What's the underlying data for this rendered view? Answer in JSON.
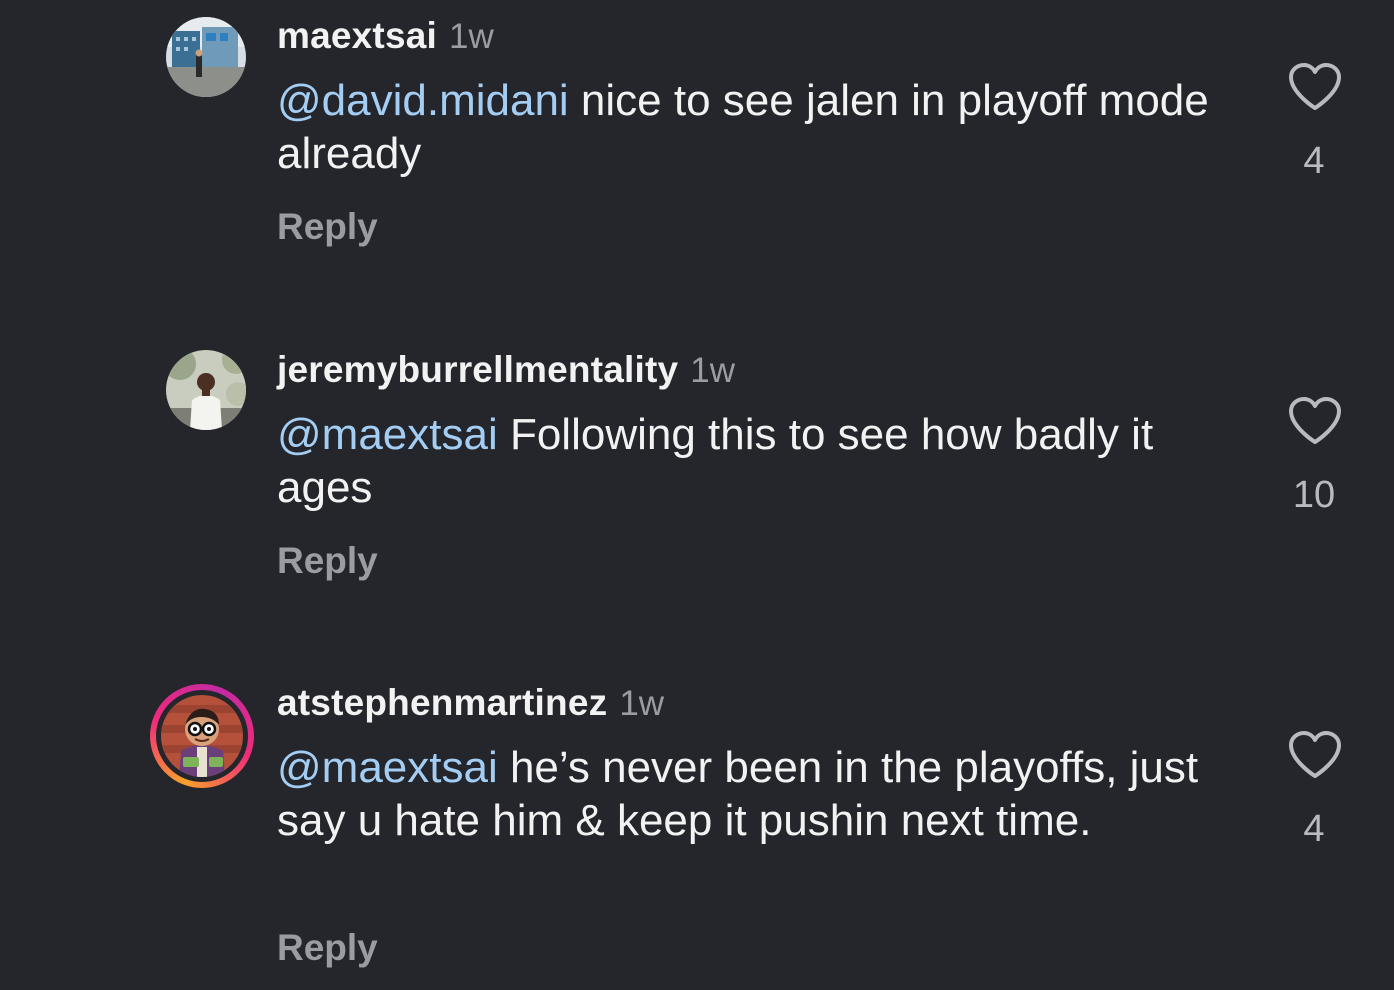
{
  "comments": [
    {
      "username": "maextsai",
      "time": "1w",
      "mention": "@david.midani",
      "text": " nice to see jalen in playoff mode already",
      "reply": "Reply",
      "likes": "4",
      "avatar_icon": "profile-photo-building",
      "has_story_ring": false
    },
    {
      "username": "jeremyburrellmentality",
      "time": "1w",
      "mention": "@maextsai",
      "text": " Following this to see how badly it ages",
      "reply": "Reply",
      "likes": "10",
      "avatar_icon": "profile-photo-person",
      "has_story_ring": false
    },
    {
      "username": "atstephenmartinez",
      "time": "1w",
      "mention": "@maextsai",
      "text": " he’s never been in the playoffs, just say u hate him & keep it pushin next time.",
      "reply": "Reply",
      "likes": "4",
      "avatar_icon": "profile-illustration-cartoon",
      "has_story_ring": true
    }
  ],
  "colors": {
    "background": "#24262b",
    "mention": "#a3cdf3",
    "muted": "#9a9ca2",
    "text": "#f2f2f2"
  }
}
